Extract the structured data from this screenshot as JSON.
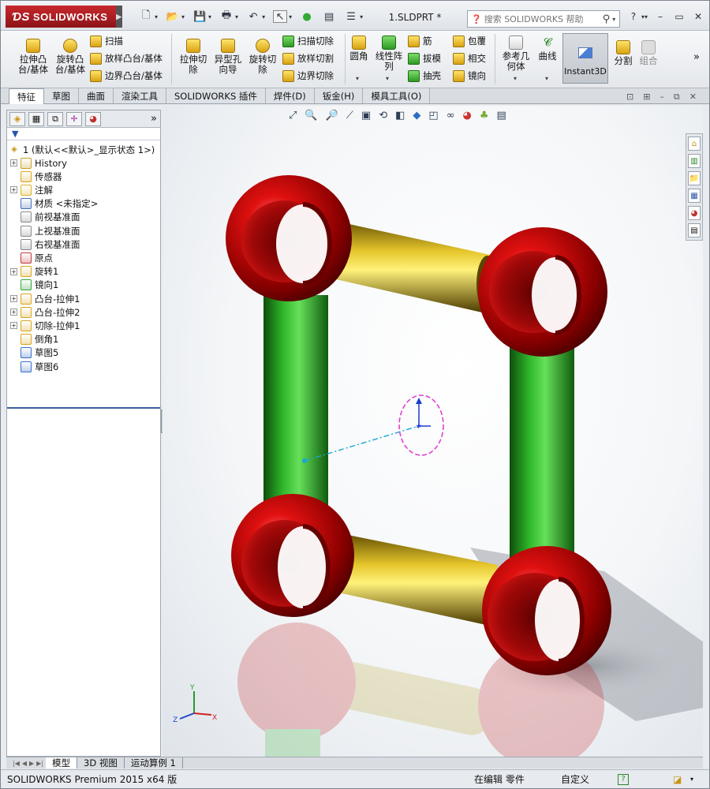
{
  "app": {
    "brand": "SOLIDWORKS",
    "doc_title": "1.SLDPRT *"
  },
  "search": {
    "placeholder": "搜索 SOLIDWORKS 帮助"
  },
  "quick_access": [
    {
      "name": "new-icon",
      "glyph": "🗋"
    },
    {
      "name": "open-icon",
      "glyph": "📂"
    },
    {
      "name": "save-icon",
      "glyph": "💾"
    },
    {
      "name": "print-icon",
      "glyph": "🖶"
    },
    {
      "name": "undo-icon",
      "glyph": "↶"
    },
    {
      "name": "select-icon",
      "glyph": "↖"
    },
    {
      "name": "rebuild-icon",
      "glyph": "●"
    },
    {
      "name": "file-properties-icon",
      "glyph": "▤"
    },
    {
      "name": "options-icon",
      "glyph": "☰"
    }
  ],
  "window_controls": {
    "help": "?",
    "minimize": "–",
    "restore": "▭",
    "close": "✕"
  },
  "features": {
    "extruded_boss": "拉伸凸\n台/基体",
    "revolved_boss": "旋转凸\n台/基体",
    "swept_boss": "扫描",
    "lofted_boss": "放样凸台/基体",
    "boundary_boss": "边界凸台/基体",
    "extruded_cut": "拉伸切\n除",
    "hole_wizard": "异型孔\n向导",
    "revolved_cut": "旋转切\n除",
    "swept_cut": "扫描切除",
    "lofted_cut": "放样切割",
    "boundary_cut": "边界切除",
    "fillet": "圆角",
    "linear_pattern": "线性阵\n列",
    "rib": "筋",
    "draft": "拔模",
    "shell": "抽壳",
    "wrap": "包覆",
    "intersect": "相交",
    "mirror": "镜向",
    "reference_geometry": "参考几\n何体",
    "curves": "曲线",
    "instant3d": "Instant3D",
    "split": "分割",
    "combine": "组合",
    "more": "»"
  },
  "tabs": [
    "特征",
    "草图",
    "曲面",
    "渲染工具",
    "SOLIDWORKS 插件",
    "焊件(D)",
    "钣金(H)",
    "模具工具(O)"
  ],
  "tree": {
    "root": "1  (默认<<默认>_显示状态 1>)",
    "items": [
      {
        "label": "History",
        "expandable": true,
        "icon_color": "#c9a227"
      },
      {
        "label": "传感器",
        "expandable": false,
        "icon_color": "#d9a51c"
      },
      {
        "label": "注解",
        "expandable": true,
        "icon_color": "#e0b22a"
      },
      {
        "label": "材质 <未指定>",
        "expandable": false,
        "icon_color": "#4a6fb5"
      },
      {
        "label": "前视基准面",
        "expandable": false,
        "icon_color": "#8a8a8a"
      },
      {
        "label": "上视基准面",
        "expandable": false,
        "icon_color": "#8a8a8a"
      },
      {
        "label": "右视基准面",
        "expandable": false,
        "icon_color": "#8a8a8a"
      },
      {
        "label": "原点",
        "expandable": false,
        "icon_color": "#c23b3b"
      },
      {
        "label": "旋转1",
        "expandable": true,
        "icon_color": "#d9a51c"
      },
      {
        "label": "镜向1",
        "expandable": false,
        "icon_color": "#3aa33a"
      },
      {
        "label": "凸台-拉伸1",
        "expandable": true,
        "icon_color": "#d9a51c"
      },
      {
        "label": "凸台-拉伸2",
        "expandable": true,
        "icon_color": "#d9a51c"
      },
      {
        "label": "切除-拉伸1",
        "expandable": true,
        "icon_color": "#d9a51c"
      },
      {
        "label": "倒角1",
        "expandable": false,
        "icon_color": "#d9a51c"
      },
      {
        "label": "草图5",
        "expandable": false,
        "icon_color": "#3a6ec9"
      },
      {
        "label": "草图6",
        "expandable": false,
        "icon_color": "#3a6ec9"
      }
    ]
  },
  "triad": {
    "x": "X",
    "y": "Y",
    "z": "Z"
  },
  "bottom_tabs": [
    "模型",
    "3D 视图",
    "运动算例 1"
  ],
  "status": {
    "app": "SOLIDWORKS Premium 2015 x64 版",
    "mode": "在编辑 零件",
    "units": "自定义",
    "help": "?"
  },
  "colors": {
    "sphere": "#c00a0a",
    "rod_green": "#2fb62a",
    "rod_yellow": "#d4b21a",
    "brand_red": "#c8282c"
  }
}
